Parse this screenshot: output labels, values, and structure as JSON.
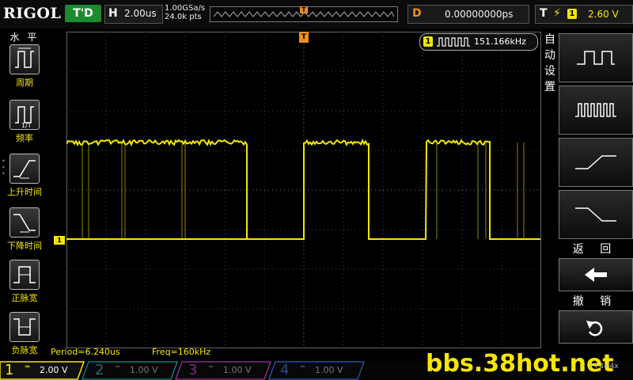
{
  "header": {
    "brand": "RIGOL",
    "run_state": "T'D",
    "horizontal": {
      "letter": "H",
      "scale": "2.00us"
    },
    "sample_rate": "1.00GSa/s",
    "memory_depth": "24.0k pts",
    "trig_top_marker": "T",
    "delay": {
      "letter": "D",
      "value": "0.00000000ps"
    },
    "trigger": {
      "letter": "T",
      "source": "1",
      "level": "2.60 V"
    }
  },
  "left_menu": {
    "title": "水 平",
    "items": [
      {
        "label": "周期",
        "icon": "period-icon"
      },
      {
        "label": "频率",
        "icon": "frequency-icon"
      },
      {
        "label": "上升时间",
        "icon": "rise-time-icon"
      },
      {
        "label": "下降时间",
        "icon": "fall-time-icon"
      },
      {
        "label": "正脉宽",
        "icon": "positive-width-icon"
      },
      {
        "label": "负脉宽",
        "icon": "negative-width-icon"
      }
    ]
  },
  "display": {
    "ch1_marker": "1",
    "trig_pos_marker": "T",
    "frequency_counter": {
      "channel": "1",
      "value": "151.166kHz"
    }
  },
  "right_menu": {
    "title": "自动设置",
    "buttons": [
      {
        "icon": "single-pulse-icon"
      },
      {
        "icon": "multi-pulse-icon"
      },
      {
        "icon": "rising-edge-icon"
      },
      {
        "icon": "falling-edge-icon"
      }
    ],
    "back_label": "返 回",
    "undo_label": "撤 销"
  },
  "measurements": {
    "period": "Period=6.240us",
    "freq": "Freq=160kHz"
  },
  "channels": [
    {
      "num": "1",
      "scale": "2.00 V",
      "active": true,
      "color": "#f6e600"
    },
    {
      "num": "2",
      "scale": "1.00 V",
      "active": false,
      "color": "#00b4b4"
    },
    {
      "num": "3",
      "scale": "1.00 V",
      "active": false,
      "color": "#c040c0"
    },
    {
      "num": "4",
      "scale": "1.00 V",
      "active": false,
      "color": "#3070e0"
    }
  ],
  "watermark": "bbs.38hot.net",
  "watermark_small": "2+4+4x"
}
